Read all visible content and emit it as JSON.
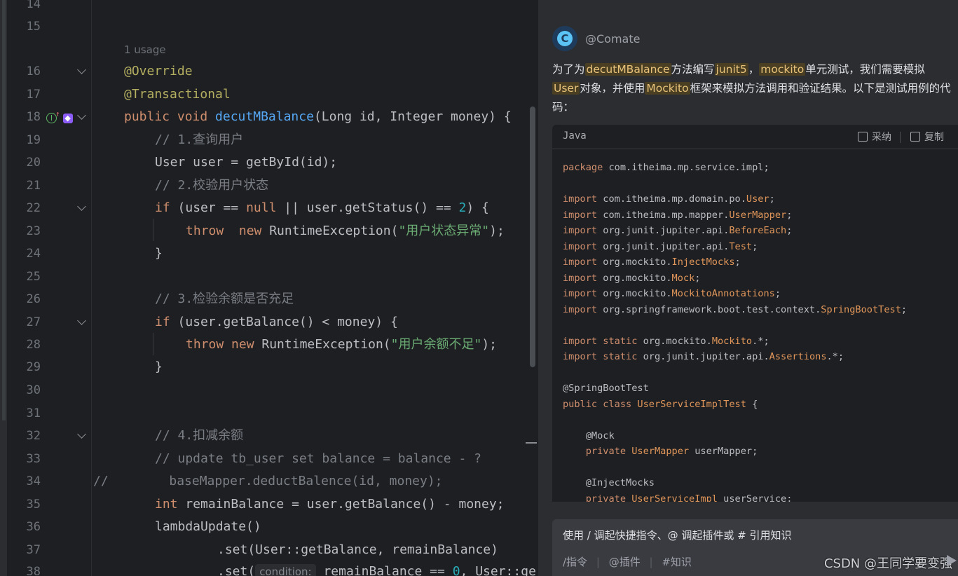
{
  "editor": {
    "usage_hint": "1 usage",
    "param_hint": "condition:",
    "lines": [
      {
        "n": "14"
      },
      {
        "n": "15"
      },
      {
        "n": "16"
      },
      {
        "n": "17"
      },
      {
        "n": "18"
      },
      {
        "n": "19"
      },
      {
        "n": "20"
      },
      {
        "n": "21"
      },
      {
        "n": "22"
      },
      {
        "n": "23"
      },
      {
        "n": "24"
      },
      {
        "n": "25"
      },
      {
        "n": "26"
      },
      {
        "n": "27"
      },
      {
        "n": "28"
      },
      {
        "n": "29"
      },
      {
        "n": "30"
      },
      {
        "n": "31"
      },
      {
        "n": "32"
      },
      {
        "n": "33"
      },
      {
        "n": "34"
      },
      {
        "n": "35"
      },
      {
        "n": "36"
      },
      {
        "n": "37"
      },
      {
        "n": "38"
      }
    ],
    "code": {
      "l16": "@Override",
      "l17": "@Transactional",
      "l18_a": "public void ",
      "l18_fn": "decutMBalance",
      "l18_b": "(Long id, Integer money) {",
      "l19": "// 1.查询用户",
      "l20": "User user = getById(id);",
      "l21": "// 2.校验用户状态",
      "l22_a": "if",
      "l22_b": " (user == ",
      "l22_null": "null",
      "l22_c": " || user.getStatus() == ",
      "l22_num": "2",
      "l22_d": ") {",
      "l23_kw1": "throw",
      "l23_kw2": "  new",
      "l23_a": " RuntimeException(",
      "l23_str": "\"用户状态异常\"",
      "l23_b": ");",
      "l24": "}",
      "l26": "// 3.检验余额是否充足",
      "l27_a": "if",
      "l27_b": " (user.getBalance() < money) {",
      "l28_kw1": "throw",
      "l28_kw2": " new",
      "l28_a": " RuntimeException(",
      "l28_str": "\"用户余额不足\"",
      "l28_b": ");",
      "l29": "}",
      "l32": "// 4.扣减余额",
      "l33": "// update tb_user set balance = balance - ?",
      "l34": "//        baseMapper.deductBalence(id, money);",
      "l35_kw": "int",
      "l35_a": " remainBalance = user.getBalance() - money;",
      "l36": "lambdaUpdate()",
      "l37": ".set(User::getBalance, remainBalance)",
      "l38_a": ".set(",
      "l38_b": " remainBalance == ",
      "l38_num": "0",
      "l38_c": ", User::ge"
    }
  },
  "panel": {
    "sender": "@Comate",
    "message": {
      "p1": "为了为",
      "h1": "decutMBalance",
      "p2": "方法编写",
      "h2": "junit5",
      "p3": "，",
      "h3": "mockito",
      "p4": "单元测试，我们需要模拟",
      "h4": "User",
      "p5": "对象，并使用",
      "h5": "Mockito",
      "p6": "框架来模拟方法调用和验证结果。以下是测试用例的代码："
    },
    "codeblock": {
      "lang": "Java",
      "adopt_label": "采纳",
      "copy_label": "复制",
      "lines": [
        {
          "k": "package",
          "t": " com.itheima.mp.service.impl;"
        },
        {
          "t": ""
        },
        {
          "k": "import",
          "t": " com.itheima.mp.domain.po.",
          "c": "User",
          ";": ";"
        },
        {
          "k": "import",
          "t": " com.itheima.mp.mapper.",
          "c": "UserMapper",
          ";": ";"
        },
        {
          "k": "import",
          "t": " org.junit.jupiter.api.",
          "c": "BeforeEach",
          ";": ";"
        },
        {
          "k": "import",
          "t": " org.junit.jupiter.api.",
          "c": "Test",
          ";": ";"
        },
        {
          "k": "import",
          "t": " org.mockito.",
          "c": "InjectMocks",
          ";": ";"
        },
        {
          "k": "import",
          "t": " org.mockito.",
          "c": "Mock",
          ";": ";"
        },
        {
          "k": "import",
          "t": " org.mockito.",
          "c": "MockitoAnnotations",
          ";": ";"
        },
        {
          "k": "import",
          "t": " org.springframework.boot.test.context.",
          "c": "SpringBootTest",
          ";": ";"
        },
        {
          "t": ""
        },
        {
          "k": "import static",
          "t": " org.mockito.",
          "c": "Mockito",
          ";": ".*;"
        },
        {
          "k": "import static",
          "t": " org.junit.jupiter.api.",
          "c": "Assertions",
          ";": ".*;"
        },
        {
          "t": ""
        },
        {
          "t": "@SpringBootTest"
        },
        {
          "k": "public class",
          "t": " ",
          "c": "UserServiceImplTest",
          ";": " {"
        },
        {
          "t": ""
        },
        {
          "t": "    @Mock"
        },
        {
          "k": "    private",
          "t": " ",
          "c": "UserMapper",
          ";": " userMapper;"
        },
        {
          "t": ""
        },
        {
          "t": "    @InjectMocks"
        },
        {
          "k": "    private",
          "t": " ",
          "c": "UserServiceImpl",
          ";": " userService;"
        }
      ]
    },
    "input": {
      "placeholder": "使用 / 调起快捷指令、@ 调起插件或 # 引用知识",
      "quick1": "/指令",
      "quick2": "@插件",
      "quick3": "#知识",
      "sep": "|"
    },
    "watermark": "CSDN @王同学要变强"
  }
}
